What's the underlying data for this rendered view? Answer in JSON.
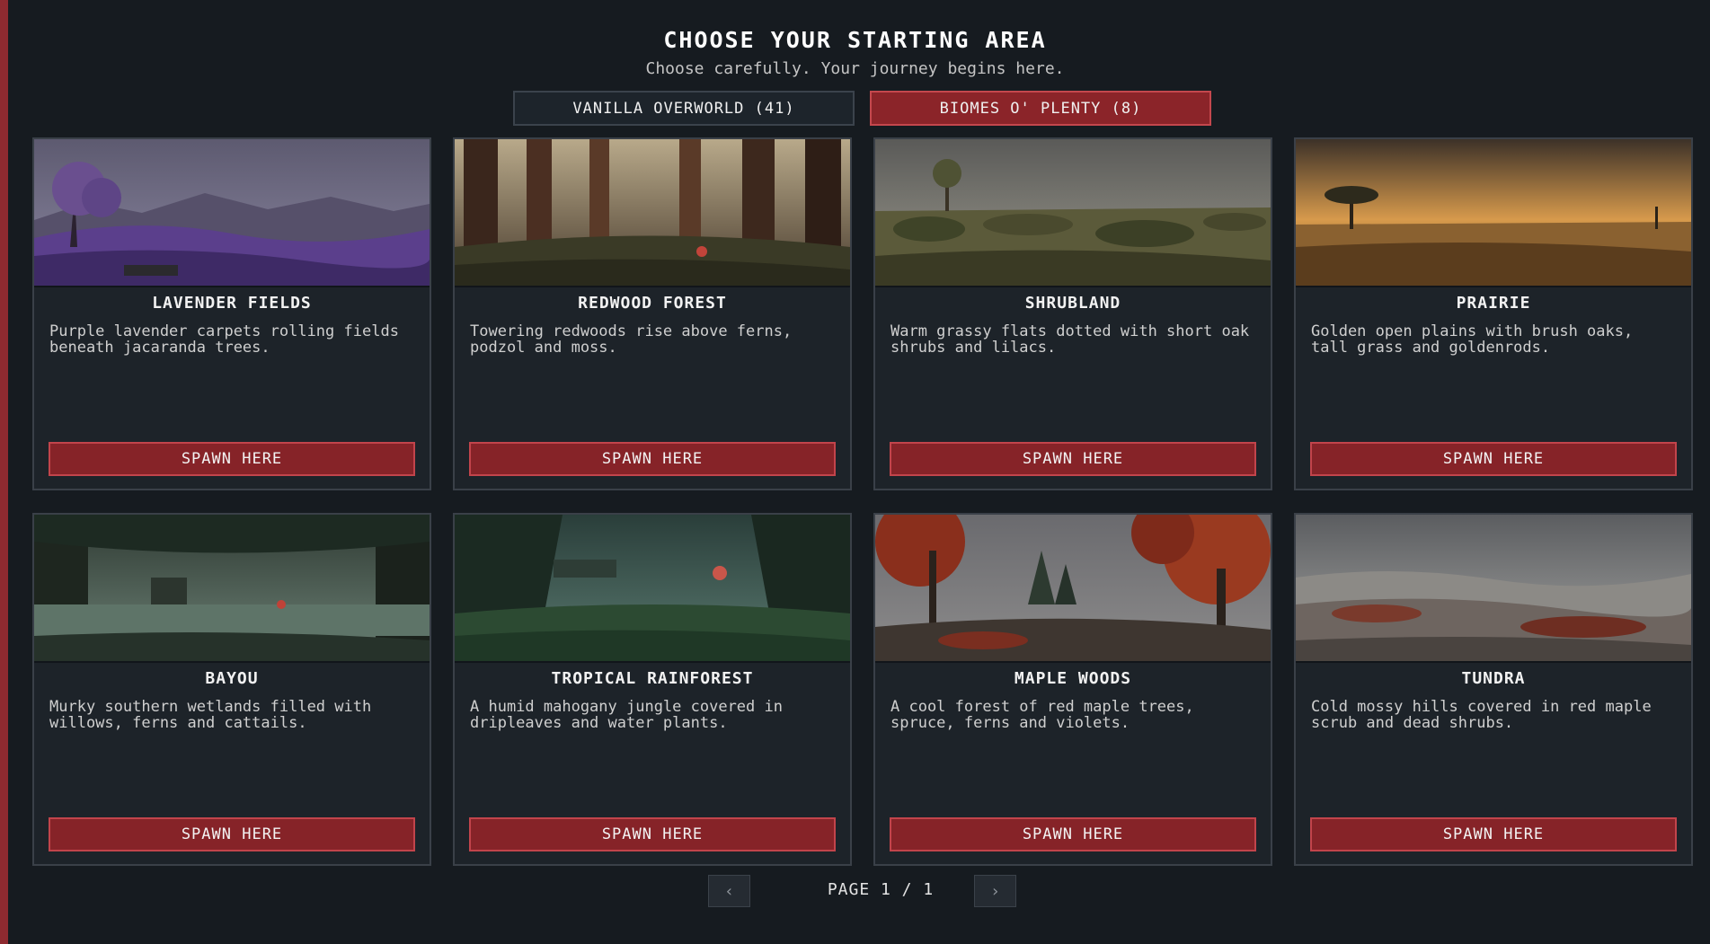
{
  "header": {
    "title": "CHOOSE YOUR STARTING AREA",
    "subtitle": "Choose carefully. Your journey begins here."
  },
  "tabs": [
    {
      "label": "VANILLA OVERWORLD (41)",
      "active": false
    },
    {
      "label": "BIOMES O' PLENTY (8)",
      "active": true
    }
  ],
  "cards": [
    {
      "name": "LAVENDER FIELDS",
      "description": "Purple lavender carpets rolling fields beneath jacaranda trees.",
      "button": "SPAWN HERE"
    },
    {
      "name": "REDWOOD FOREST",
      "description": "Towering redwoods rise above ferns, podzol and moss.",
      "button": "SPAWN HERE"
    },
    {
      "name": "SHRUBLAND",
      "description": "Warm grassy flats dotted with short oak shrubs and lilacs.",
      "button": "SPAWN HERE"
    },
    {
      "name": "PRAIRIE",
      "description": "Golden open plains with brush oaks, tall grass and goldenrods.",
      "button": "SPAWN HERE"
    },
    {
      "name": "BAYOU",
      "description": "Murky southern wetlands filled with willows, ferns and cattails.",
      "button": "SPAWN HERE"
    },
    {
      "name": "TROPICAL RAINFOREST",
      "description": "A humid mahogany jungle covered in dripleaves and water plants.",
      "button": "SPAWN HERE"
    },
    {
      "name": "MAPLE WOODS",
      "description": "A cool forest of red maple trees, spruce, ferns and violets.",
      "button": "SPAWN HERE"
    },
    {
      "name": "TUNDRA",
      "description": "Cold mossy hills covered in red maple scrub and dead shrubs.",
      "button": "SPAWN HERE"
    }
  ],
  "pager": {
    "prev_icon": "chevron-left-icon",
    "next_icon": "chevron-right-icon",
    "label": "PAGE 1 / 1"
  },
  "colors": {
    "accent": "#8b2429",
    "accent_border": "#c4474d",
    "background": "#161b20",
    "card": "#1d2329"
  }
}
